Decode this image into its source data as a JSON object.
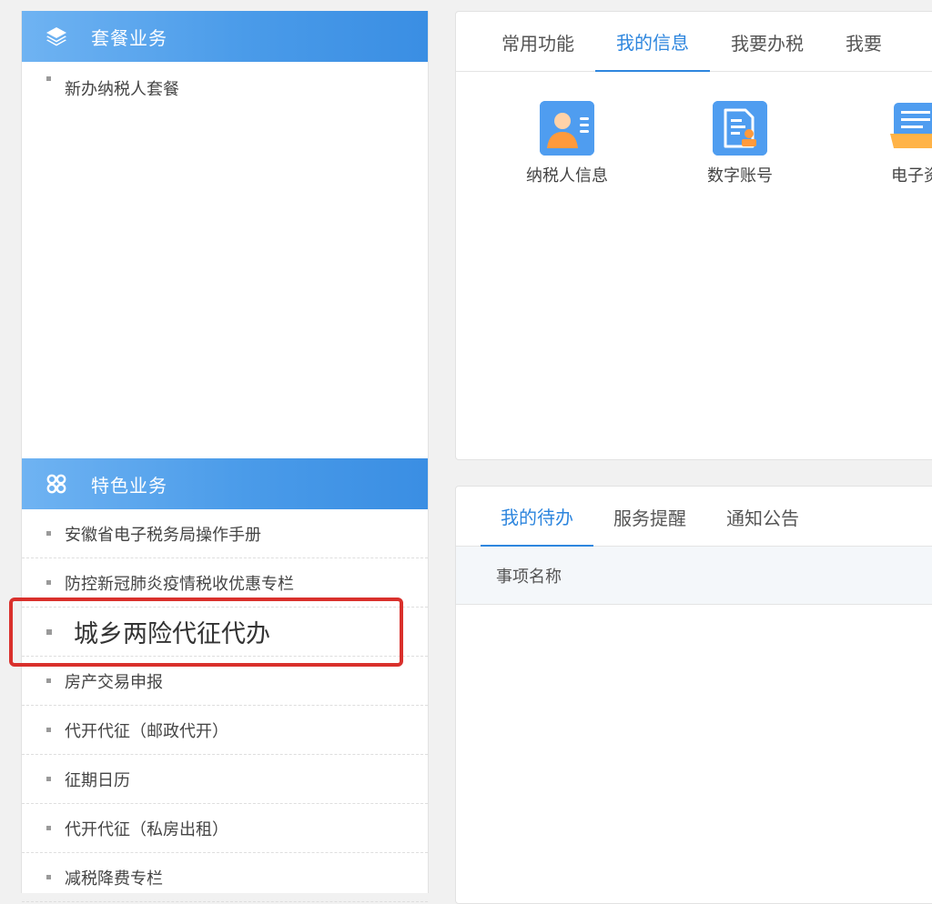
{
  "sidebar": {
    "package_section": {
      "title": "套餐业务",
      "items": [
        {
          "label": "新办纳税人套餐"
        }
      ]
    },
    "feature_section": {
      "title": "特色业务",
      "items": [
        {
          "label": "安徽省电子税务局操作手册"
        },
        {
          "label": "防控新冠肺炎疫情税收优惠专栏"
        },
        {
          "label": "城乡两险代征代办"
        },
        {
          "label": "房产交易申报"
        },
        {
          "label": "代开代征（邮政代开）"
        },
        {
          "label": "征期日历"
        },
        {
          "label": "代开代征（私房出租）"
        },
        {
          "label": "减税降费专栏"
        }
      ]
    }
  },
  "info_panel": {
    "tabs": [
      {
        "label": "常用功能"
      },
      {
        "label": "我的信息"
      },
      {
        "label": "我要办税"
      },
      {
        "label": "我要"
      }
    ],
    "active_tab": "我的信息",
    "icons": [
      {
        "label": "纳税人信息",
        "icon": "taxpayer-id-card-icon"
      },
      {
        "label": "数字账号",
        "icon": "digital-account-document-icon"
      },
      {
        "label": "电子资",
        "icon": "electronic-archive-icon"
      }
    ]
  },
  "todo_panel": {
    "tabs": [
      {
        "label": "我的待办"
      },
      {
        "label": "服务提醒"
      },
      {
        "label": "通知公告"
      }
    ],
    "active_tab": "我的待办",
    "table": {
      "columns": [
        "事项名称"
      ]
    }
  },
  "colors": {
    "accent": "#2e86de",
    "header_gradient_start": "#6fb3f2",
    "header_gradient_end": "#3a8ee3",
    "highlight_border": "#d9302c"
  }
}
